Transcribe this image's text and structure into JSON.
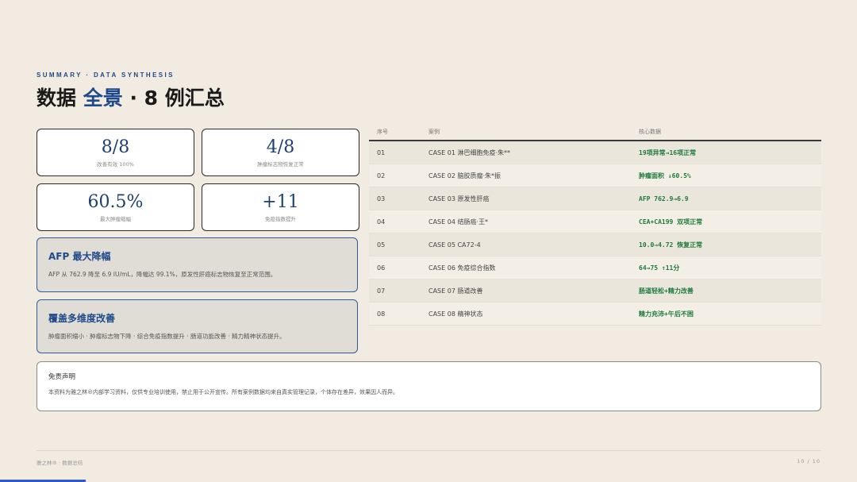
{
  "header": {
    "eyebrow": "SUMMARY · DATA SYNTHESIS",
    "title_prefix": "数据 ",
    "title_accent": "全景",
    "title_suffix": " · 8 例汇总"
  },
  "stats": [
    {
      "value": "8/8",
      "label": "改善有效 100%"
    },
    {
      "value": "4/8",
      "label": "肿瘤标志物恢复正常"
    },
    {
      "value": "60.5%",
      "label": "最大肿瘤缩幅"
    },
    {
      "value": "+11",
      "label": "免疫指数提升"
    }
  ],
  "highlights": [
    {
      "title": "AFP 最大降幅",
      "text": "AFP 从 762.9 降至 6.9 IU/mL，降幅达 99.1%，原发性肝癌标志物恢复至正常范围。"
    },
    {
      "title": "覆盖多维度改善",
      "text": "肿瘤面积缩小 · 肿瘤标志物下降 · 综合免疫指数提升 · 肠道功能改善 · 精力精神状态提升。"
    }
  ],
  "table": {
    "headers": [
      "序号",
      "案例",
      "核心数据"
    ],
    "rows": [
      [
        "01",
        "CASE 01 淋巴细胞免疫·朱**",
        "19项异常→16项正常"
      ],
      [
        "02",
        "CASE 02 脑胶质瘤·朱*振",
        "肿瘤面积 ↓60.5%"
      ],
      [
        "03",
        "CASE 03 原发性肝癌",
        "AFP 762.9→6.9"
      ],
      [
        "04",
        "CASE 04 结肠癌·王*",
        "CEA+CA199 双项正常"
      ],
      [
        "05",
        "CASE 05 CA72-4",
        "10.0→4.72 恢复正常"
      ],
      [
        "06",
        "CASE 06 免疫综合指数",
        "64→75 ↑11分"
      ],
      [
        "07",
        "CASE 07 肠道改善",
        "肠道轻松+精力改善"
      ],
      [
        "08",
        "CASE 08 精神状态",
        "精力充沛+午后不困"
      ]
    ]
  },
  "disclaimer": {
    "title": "免责声明",
    "text": "本资料为雅之林®内部学习资料，仅供专业培训使用，禁止用于公开宣传。所有案例数据均来自真实管理记录，个体存在差异，效果因人而异。"
  },
  "footer": {
    "left": "雅之林® · 数据总结",
    "page": "10 / 10",
    "progress": 0.1
  },
  "colors": {
    "accent": "#1f4a8a",
    "data_green": "#1e7a3a",
    "background": "#f1ebe1"
  }
}
